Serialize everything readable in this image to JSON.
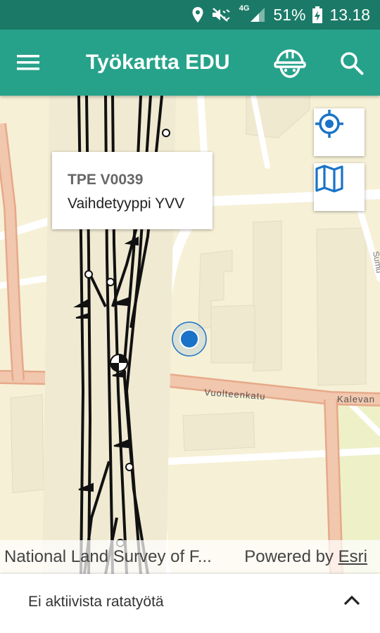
{
  "status_bar": {
    "battery": "51%",
    "time": "13.18",
    "network": "4G",
    "icons": [
      "location-icon",
      "mute-icon",
      "signal-icon",
      "battery-charging-icon"
    ]
  },
  "app_bar": {
    "title": "Työkartta EDU",
    "icons": [
      "menu-icon",
      "worker-helmet-icon",
      "search-icon"
    ],
    "background": "#27a28a",
    "status_color": "#1b7a67"
  },
  "map": {
    "street_labels": {
      "vuolteenkatu": "Vuolteenkatu",
      "kalevan": "Kalevan",
      "sumu": "Sumu"
    },
    "popup": {
      "title": "TPE V0039",
      "subtitle": "Vaihdetyyppi YVV"
    },
    "controls": [
      "my-location-icon",
      "map-layers-icon"
    ],
    "accent": "#1a73c8"
  },
  "attribution": {
    "source": "National Land Survey of F...",
    "powered_prefix": "Powered by",
    "powered_link": "Esri"
  },
  "bottom_panel": {
    "label": "Ei aktiivista ratatyötä"
  }
}
